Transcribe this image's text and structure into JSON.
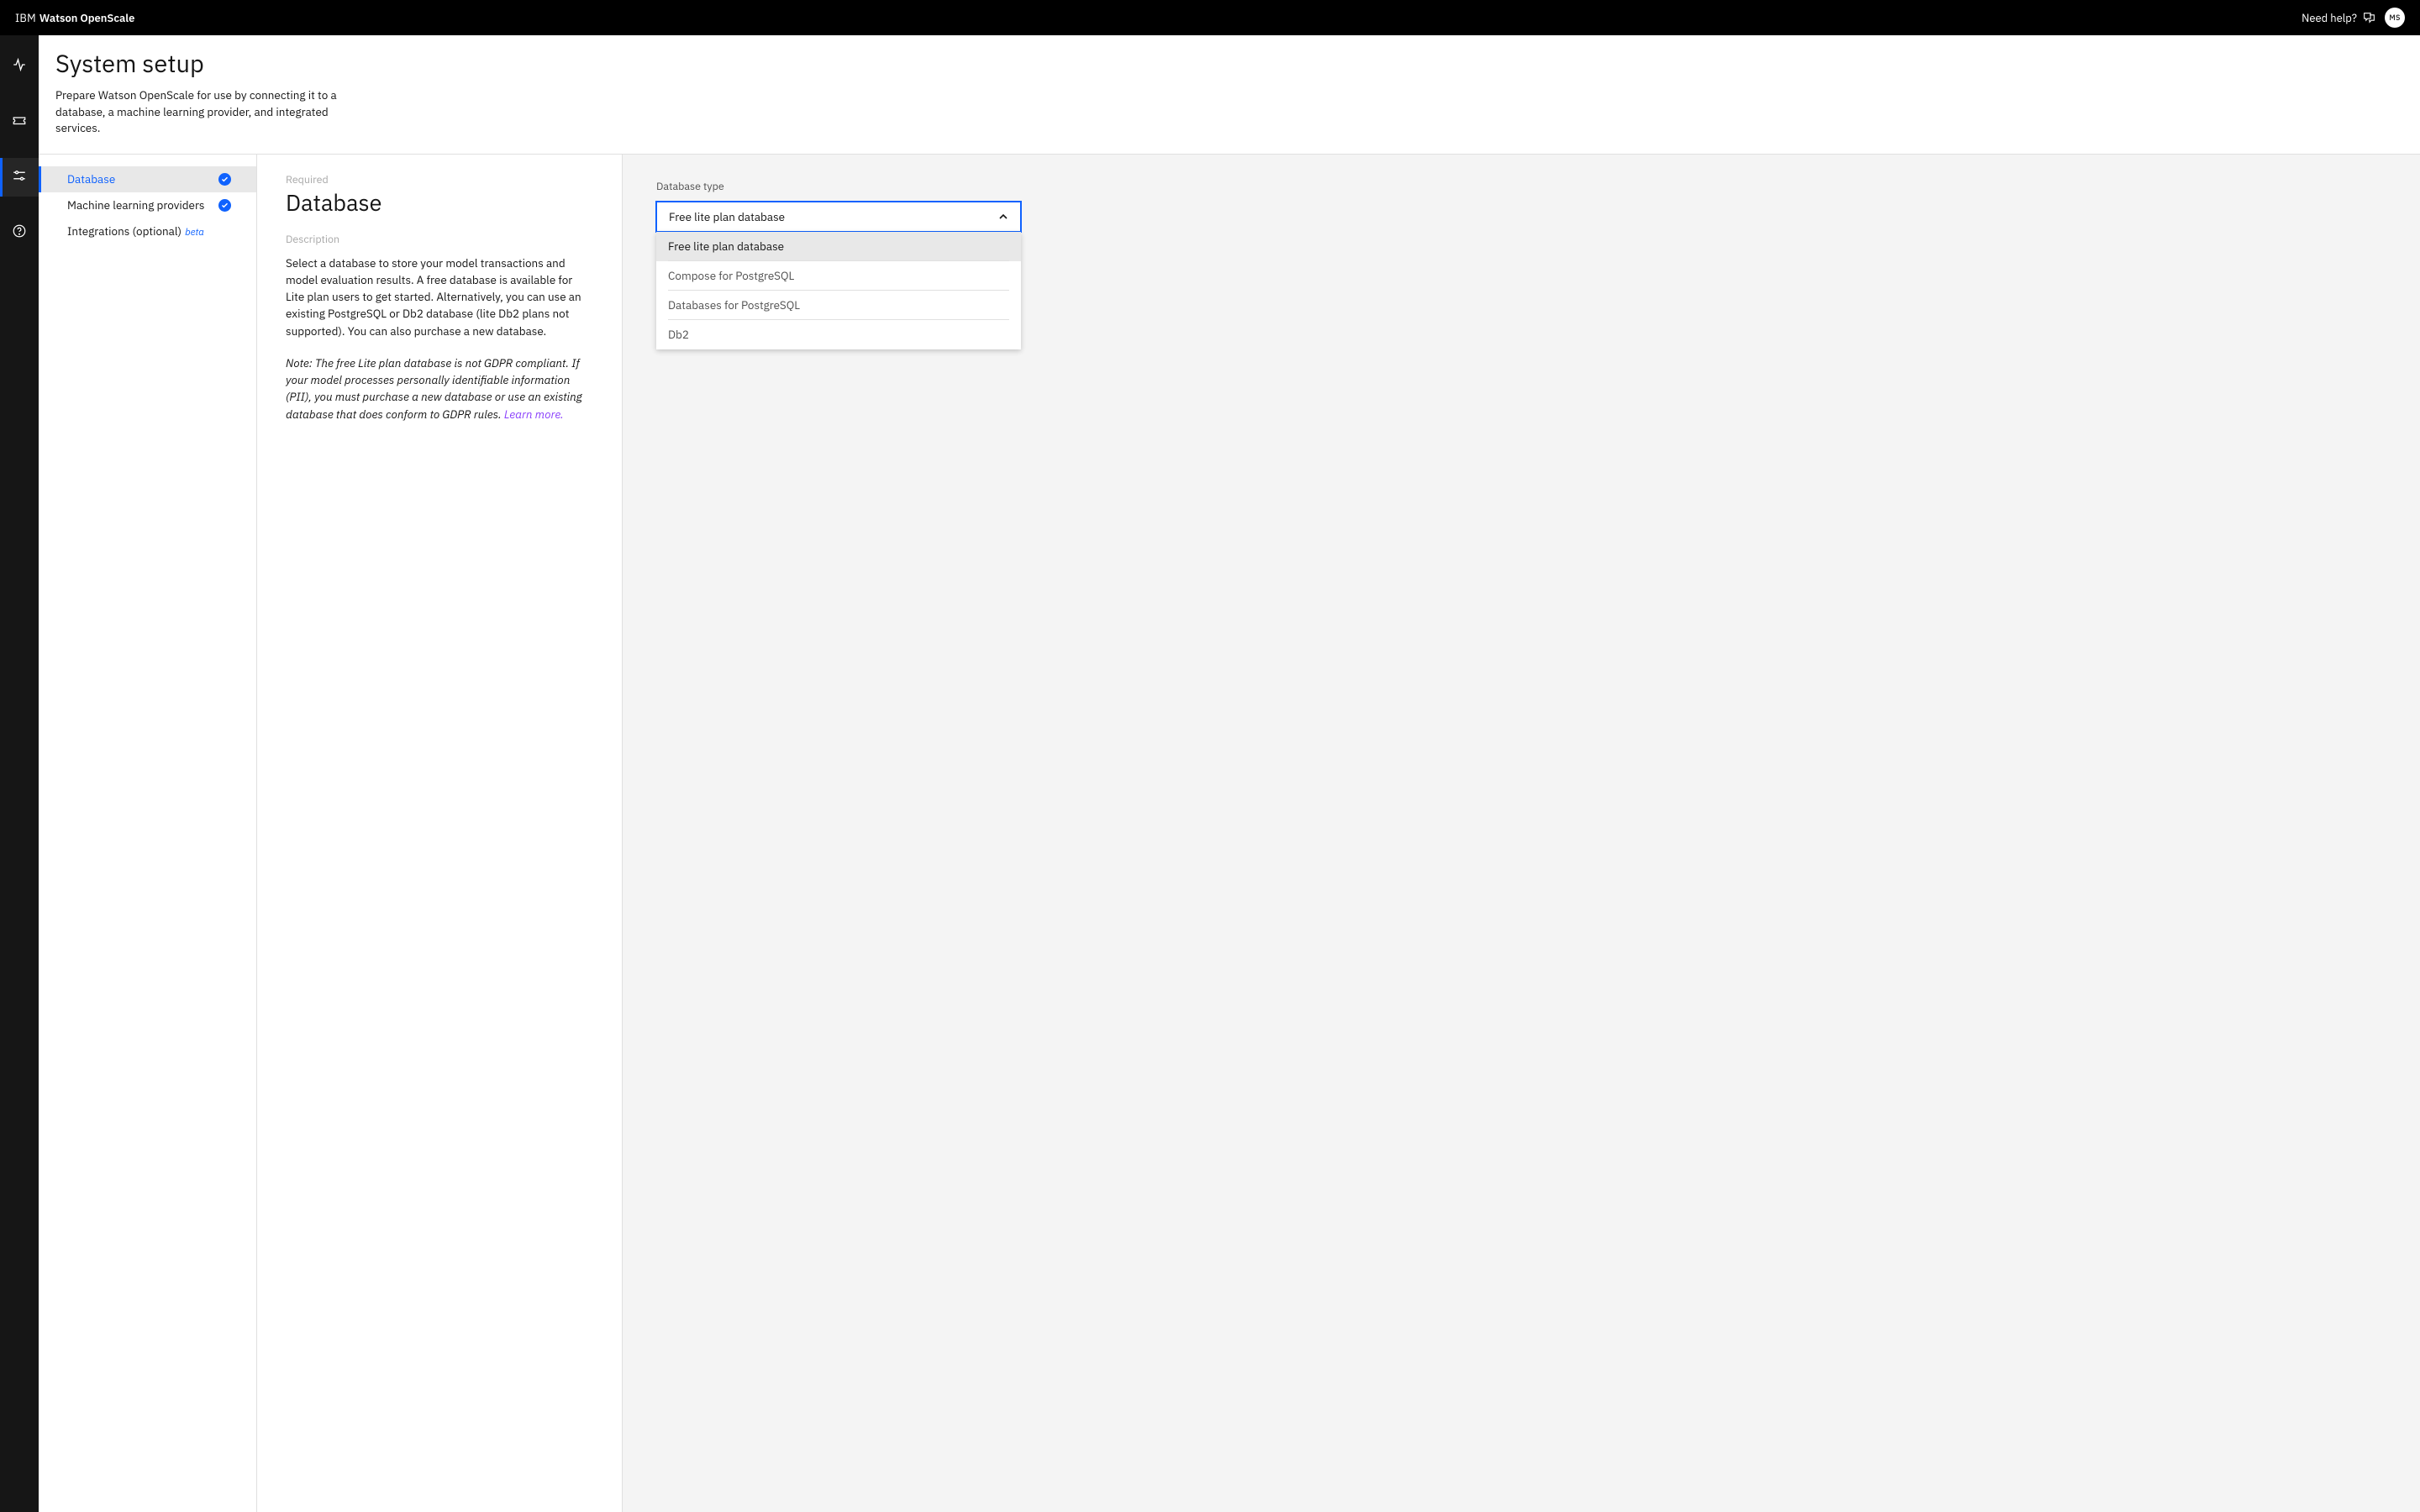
{
  "topbar": {
    "brand_prefix": "IBM",
    "brand_product": "Watson OpenScale",
    "need_help": "Need help?",
    "avatar_initials": "MS"
  },
  "rail": {
    "items": [
      {
        "name": "activity-icon"
      },
      {
        "name": "ticket-icon"
      },
      {
        "name": "settings-icon"
      },
      {
        "name": "help-icon"
      }
    ]
  },
  "page": {
    "title": "System setup",
    "subtitle": "Prepare Watson OpenScale for use by connecting it to a database, a machine learning provider, and integrated services."
  },
  "sidebar": {
    "items": [
      {
        "label": "Database",
        "status": "done",
        "active": true
      },
      {
        "label": "Machine learning providers",
        "status": "done",
        "active": false
      },
      {
        "label": "Integrations (optional)",
        "badge": "beta",
        "active": false
      }
    ]
  },
  "desc": {
    "required": "Required",
    "heading": "Database",
    "description_label": "Description",
    "description_text": "Select a database to store your model transactions and model evaluation results. A free database is available for Lite plan users to get started. Alternatively, you can use an existing PostgreSQL or Db2 database (lite Db2 plans not supported). You can also purchase a new database.",
    "note_text": "Note: The free Lite plan database is not GDPR compliant. If your model processes personally identifiable information (PII), you must purchase a new database or use an existing database that does conform to GDPR rules. ",
    "learn_more": "Learn more."
  },
  "form": {
    "db_type_label": "Database type",
    "selected": "Free lite plan database",
    "options": [
      "Free lite plan database",
      "Compose for PostgreSQL",
      "Databases for PostgreSQL",
      "Db2"
    ]
  }
}
